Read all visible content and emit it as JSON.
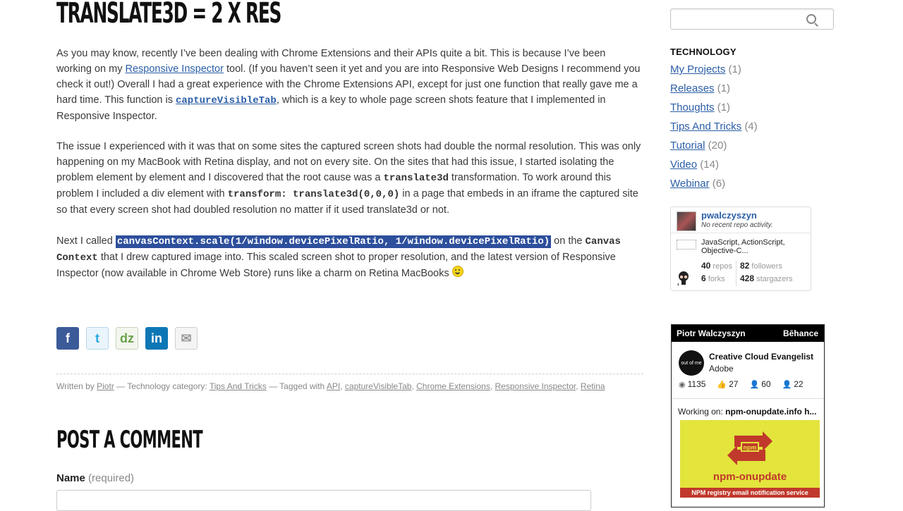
{
  "post": {
    "title": "TRANSLATE3D = 2 X RES",
    "p1": {
      "t1": "As you may know, recently I’ve been dealing with Chrome Extensions and their APIs quite a bit. This is because I’ve been working on my ",
      "link1": "Responsive Inspector",
      "t2": " tool. (If you haven’t seen it yet and you are into Responsive Web Designs I recommend you check it out!) Overall I had a great experience with the Chrome Extensions API, except for just one function that really gave me a hard time. This function is ",
      "code_link": "captureVisibleTab",
      "t3": ", which is a key to whole page screen shots feature that I implemented in Responsive Inspector."
    },
    "p2": {
      "t1": "The issue I experienced with it was that on some sites the captured screen shots had double the normal resolution. This was only happening on my MacBook with Retina display, and not on every site. On the sites that had this issue, I started isolating the problem element by element and I discovered that the root cause was a ",
      "code1": "translate3d",
      "t2": " transformation. To work around this problem I included a div element with ",
      "code2": "transform: translate3d(0,0,0)",
      "t3": " in a page that embeds in an iframe the captured site so that every screen shot had doubled resolution no matter if it used translate3d or not."
    },
    "p3": {
      "t1": "Next I called ",
      "highlight": "canvasContext.scale(1/window.devicePixelRatio, 1/window.devicePixelRatio)",
      "t2": " on the ",
      "code1": "Canvas Context",
      "t3": " that I drew captured image into. This scaled screen shot to proper resolution, and the latest version of Responsive Inspector (now available in Chrome Web Store) runs like a charm on Retina MacBooks "
    },
    "share": [
      {
        "name": "facebook-share-button",
        "glyph": "f"
      },
      {
        "name": "twitter-share-button",
        "glyph": "t"
      },
      {
        "name": "dzone-share-button",
        "glyph": "dz"
      },
      {
        "name": "linkedin-share-button",
        "glyph": "in"
      },
      {
        "name": "email-share-button",
        "glyph": "✉"
      }
    ],
    "meta": {
      "written_by": "Written by ",
      "author": "Piotr",
      "category_prefix": " — Technology category: ",
      "category": "Tips And Tricks",
      "tagged_prefix": " — Tagged with ",
      "tags": [
        "API",
        "captureVisibleTab",
        "Chrome Extensions",
        "Responsive Inspector",
        "Retina"
      ]
    }
  },
  "comment": {
    "title": "POST A COMMENT",
    "name_label": "Name",
    "name_required": "(required)"
  },
  "sidebar": {
    "search_placeholder": "",
    "category_heading": "TECHNOLOGY",
    "categories": [
      {
        "label": "My Projects",
        "count": "(1)"
      },
      {
        "label": "Releases",
        "count": "(1)"
      },
      {
        "label": "Thoughts",
        "count": "(1)"
      },
      {
        "label": "Tips And Tricks",
        "count": "(4)"
      },
      {
        "label": "Tutorial",
        "count": "(20)"
      },
      {
        "label": "Video",
        "count": "(14)"
      },
      {
        "label": "Webinar",
        "count": "(6)"
      }
    ],
    "github": {
      "username": "pwalczyszyn",
      "activity": "No recent repo activity.",
      "languages": "JavaScript, ActionScript, Objective-C...",
      "repos_count": "40",
      "repos_label": "repos",
      "followers_count": "82",
      "followers_label": "followers",
      "forks_count": "6",
      "forks_label": "forks",
      "stargazers_count": "428",
      "stargazers_label": "stargazers"
    },
    "behance": {
      "name": "Piotr Walczyszyn",
      "brand": "Bēhance",
      "logo_text": "out of me",
      "role": "Creative Cloud Evangelist",
      "company": "Adobe",
      "views": "1135",
      "appreciations": "27",
      "followers": "60",
      "following": "22",
      "working_prefix": "Working on: ",
      "working_project": "npm-onupdate.info h...",
      "thumb_title": "npm-onupdate",
      "thumb_desc": "NPM registry email notification service"
    }
  }
}
